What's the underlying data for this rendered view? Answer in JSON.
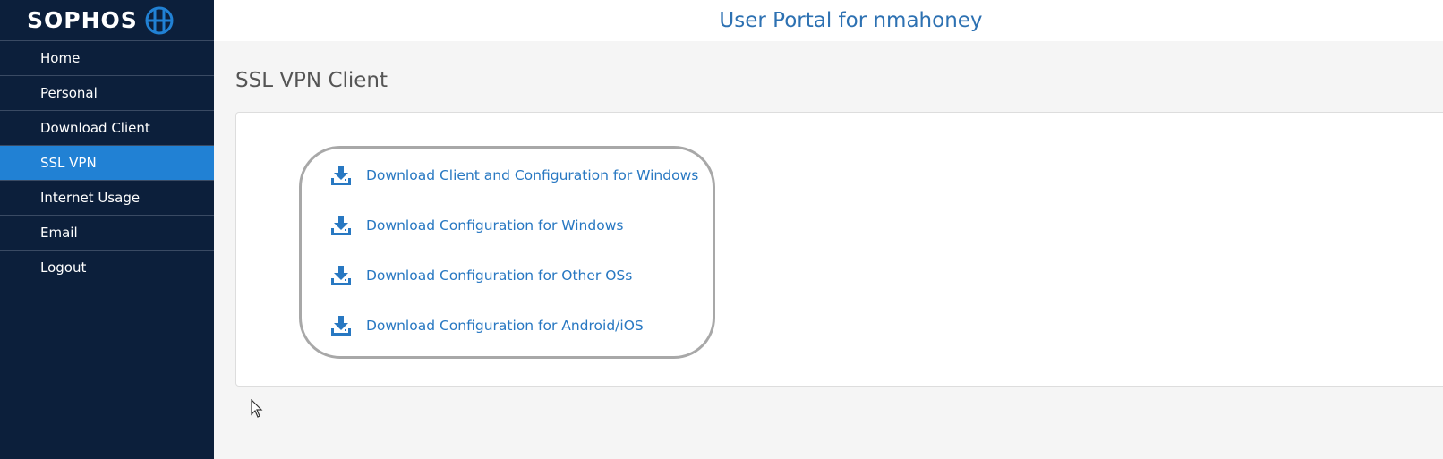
{
  "brand": {
    "name": "SOPHOS",
    "logo_icon": "globe-grid-icon"
  },
  "header": {
    "title": "User Portal for nmahoney"
  },
  "sidebar": {
    "items": [
      {
        "label": "Home",
        "active": false
      },
      {
        "label": "Personal",
        "active": false
      },
      {
        "label": "Download Client",
        "active": false
      },
      {
        "label": "SSL VPN",
        "active": true
      },
      {
        "label": "Internet Usage",
        "active": false
      },
      {
        "label": "Email",
        "active": false
      },
      {
        "label": "Logout",
        "active": false
      }
    ]
  },
  "main": {
    "section_title": "SSL VPN Client",
    "downloads": [
      {
        "label": "Download Client and Configuration for Windows",
        "icon": "download-tray-icon"
      },
      {
        "label": "Download Configuration for Windows",
        "icon": "download-tray-icon"
      },
      {
        "label": "Download Configuration for Other OSs",
        "icon": "download-tray-icon"
      },
      {
        "label": "Download Configuration for Android/iOS",
        "icon": "download-tray-icon"
      }
    ]
  },
  "colors": {
    "sidebar_bg": "#0c1f3b",
    "active_item": "#2181d4",
    "link": "#2878c2",
    "title": "#2d71b2"
  }
}
